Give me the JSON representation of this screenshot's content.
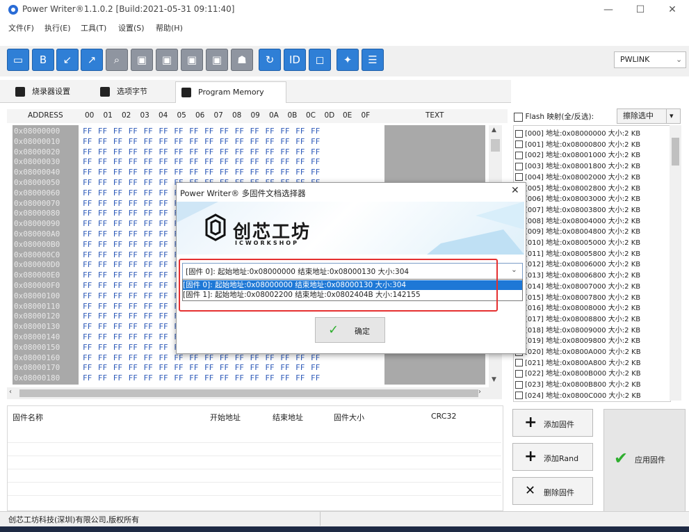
{
  "window": {
    "title": "Power Writer®1.1.0.2 [Build:2021-05-31 09:11:40]",
    "minimize": "—",
    "maximize": "☐",
    "close": "✕"
  },
  "menu": [
    "文件(F)",
    "执行(E)",
    "工具(T)",
    "设置(S)",
    "帮助(H)"
  ],
  "toolbar": {
    "icons": [
      "open-icon",
      "save-icon",
      "export-icon",
      "upload-icon",
      "search-icon",
      "read-icon",
      "write-icon",
      "verify-icon",
      "erase-icon",
      "robot-icon",
      "refresh-icon",
      "id-icon",
      "stop-icon",
      "magic-icon",
      "script-icon"
    ],
    "port": "PWLINK"
  },
  "tabs": [
    "烧录器设置",
    "选项字节",
    "Program Memory"
  ],
  "hex": {
    "header": {
      "address": "ADDRESS",
      "cols": [
        "00",
        "01",
        "02",
        "03",
        "04",
        "05",
        "06",
        "07",
        "08",
        "09",
        "0A",
        "0B",
        "0C",
        "0D",
        "0E",
        "0F"
      ],
      "text": "TEXT"
    },
    "addresses": [
      "0x08000000",
      "0x08000010",
      "0x08000020",
      "0x08000030",
      "0x08000040",
      "0x08000050",
      "0x08000060",
      "0x08000070",
      "0x08000080",
      "0x08000090",
      "0x080000A0",
      "0x080000B0",
      "0x080000C0",
      "0x080000D0",
      "0x080000E0",
      "0x080000F0",
      "0x08000100",
      "0x08000110",
      "0x08000120",
      "0x08000130",
      "0x08000140",
      "0x08000150",
      "0x08000160",
      "0x08000170",
      "0x08000180"
    ],
    "row_bytes": "FF FF FF FF FF FF FF FF FF FF FF FF FF FF FF FF"
  },
  "flash": {
    "header_label": "Flash 映射(全/反选):",
    "erase_button": "擦除选中",
    "items": [
      "[000] 地址:0x08000000 大小:2 KB",
      "[001] 地址:0x08000800 大小:2 KB",
      "[002] 地址:0x08001000 大小:2 KB",
      "[003] 地址:0x08001800 大小:2 KB",
      "[004] 地址:0x08002000 大小:2 KB",
      "[005] 地址:0x08002800 大小:2 KB",
      "[006] 地址:0x08003000 大小:2 KB",
      "[007] 地址:0x08003800 大小:2 KB",
      "[008] 地址:0x08004000 大小:2 KB",
      "[009] 地址:0x08004800 大小:2 KB",
      "[010] 地址:0x08005000 大小:2 KB",
      "[011] 地址:0x08005800 大小:2 KB",
      "[012] 地址:0x08006000 大小:2 KB",
      "[013] 地址:0x08006800 大小:2 KB",
      "[014] 地址:0x08007000 大小:2 KB",
      "[015] 地址:0x08007800 大小:2 KB",
      "[016] 地址:0x08008000 大小:2 KB",
      "[017] 地址:0x08008800 大小:2 KB",
      "[018] 地址:0x08009000 大小:2 KB",
      "[019] 地址:0x08009800 大小:2 KB",
      "[020] 地址:0x0800A000 大小:2 KB",
      "[021] 地址:0x0800A800 大小:2 KB",
      "[022] 地址:0x0800B000 大小:2 KB",
      "[023] 地址:0x0800B800 大小:2 KB",
      "[024] 地址:0x0800C000 大小:2 KB"
    ]
  },
  "firmware_table": {
    "headers": [
      "固件名称",
      "开始地址",
      "结束地址",
      "固件大小",
      "CRC32"
    ]
  },
  "buttons": {
    "add_firmware": "添加固件",
    "add_rand": "添加Rand",
    "delete_firmware": "删除固件",
    "apply_firmware": "应用固件"
  },
  "status": "创芯工坊科技(深圳)有限公司,版权所有",
  "dialog": {
    "title": "Power Writer® 多固件文档选择器",
    "logo_cn": "创芯工坊",
    "logo_en": "ICWORKSHOP",
    "selected": "[固件 0]:   起始地址:0x08000000   结束地址:0x08000130   大小:304",
    "options": [
      "[固件 0]:   起始地址:0x08000000   结束地址:0x08000130   大小:304",
      "[固件 1]:   起始地址:0x08002200   结束地址:0x0802404B   大小:142155"
    ],
    "ok": "确定"
  },
  "colors": {
    "toolbar_blue": "#2f7fd6",
    "hex_blue": "#2c59b8",
    "selection": "#1e78d6",
    "highlight_red": "#e53030",
    "ok_green": "#2fae2f"
  }
}
